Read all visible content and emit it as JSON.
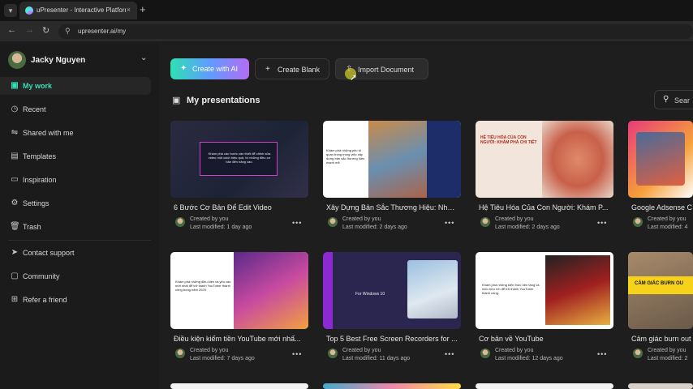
{
  "browser": {
    "tab_title": "uPresenter - Interactive Platform",
    "tab_close": "×",
    "new_tab": "+",
    "url": "upresenter.ai/my"
  },
  "sidebar": {
    "user_name": "Jacky Nguyen",
    "items": [
      {
        "label": "My work",
        "icon": "folder-icon"
      },
      {
        "label": "Recent",
        "icon": "clock-icon"
      },
      {
        "label": "Shared with me",
        "icon": "share-icon"
      },
      {
        "label": "Templates",
        "icon": "template-icon"
      },
      {
        "label": "Inspiration",
        "icon": "book-icon"
      },
      {
        "label": "Settings",
        "icon": "gear-icon"
      },
      {
        "label": "Trash",
        "icon": "trash-icon"
      }
    ],
    "support_items": [
      {
        "label": "Contact support",
        "icon": "send-icon"
      },
      {
        "label": "Community",
        "icon": "chat-icon"
      },
      {
        "label": "Refer a friend",
        "icon": "gift-icon"
      }
    ]
  },
  "toolbar": {
    "create_ai_label": "Create with AI",
    "create_blank_label": "Create Blank",
    "import_label": "Import Document"
  },
  "section": {
    "title": "My presentations",
    "search_placeholder": "Sear"
  },
  "presentations": [
    {
      "title": "6 Bước Cơ Bản Để Edit Video",
      "creator": "Created by you",
      "modified": "Last modified: 1 day ago",
      "thumb_text": "Khám phá các bước cần thiết để chỉnh sửa video một cách hiệu quả, từ những điều cơ bản đến nâng cao."
    },
    {
      "title": "Xây Dựng Bản Sắc Thương Hiệu: Những...",
      "creator": "Created by you",
      "modified": "Last modified: 2 days ago",
      "thumb_text": "Khám phá những yếu tố quan trọng trong việc xây dựng bản sắc thương hiệu mạnh mẽ."
    },
    {
      "title": "Hệ Tiêu Hóa Của Con Người: Khám P...",
      "creator": "Created by you",
      "modified": "Last modified: 2 days ago",
      "thumb_text": "HỆ TIÊU HÓA CỦA CON NGƯỜI: KHÁM PHÁ CHI TIẾT"
    },
    {
      "title": "Google Adsense C",
      "creator": "Created by you",
      "modified": "Last modified: 4",
      "thumb_text": ""
    },
    {
      "title": "Điều kiện kiếm tiền YouTube mới nhấ...",
      "creator": "Created by you",
      "modified": "Last modified: 7 days ago",
      "thumb_text": "Khám phá những điều kiện và yêu cầu mới nhất để trở thành YouTuber thành công trong năm 2025."
    },
    {
      "title": "Top 5 Best Free Screen Recorders for ...",
      "creator": "Created by you",
      "modified": "Last modified: 11 days ago",
      "thumb_text": "For Windows 10"
    },
    {
      "title": "Cơ bản về YouTube",
      "creator": "Created by you",
      "modified": "Last modified: 12 days ago",
      "thumb_text": "Khám phá những kiến thức nền tảng và mẹo hữu ích để trở thành YouTuber thành công."
    },
    {
      "title": "Cảm giác burn out",
      "creator": "Created by you",
      "modified": "Last modified: 2",
      "thumb_text": "CẢM GIÁC BURN OU"
    }
  ]
}
